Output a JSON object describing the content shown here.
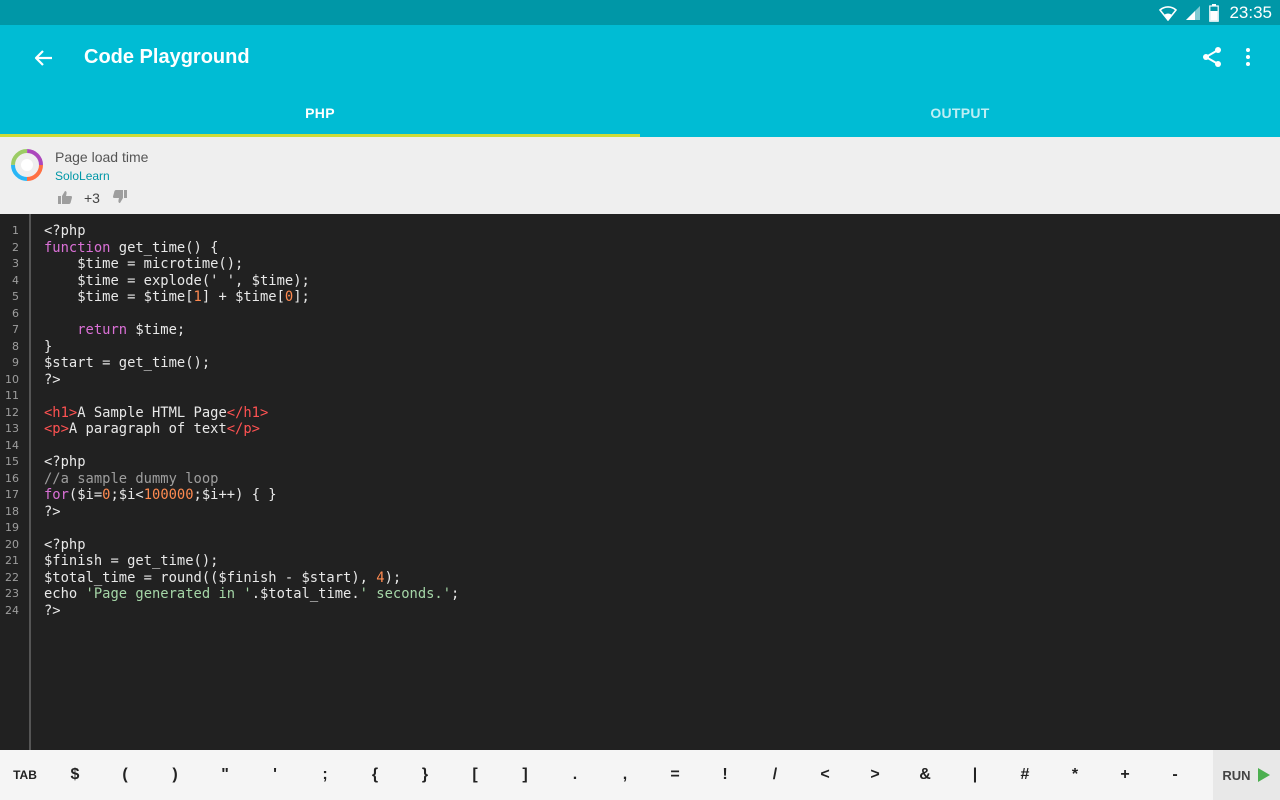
{
  "status": {
    "time": "23:35"
  },
  "appbar": {
    "title": "Code Playground"
  },
  "tabs": [
    {
      "label": "PHP"
    },
    {
      "label": "OUTPUT"
    }
  ],
  "info": {
    "title": "Page load time",
    "author": "SoloLearn",
    "votes": "+3"
  },
  "code_lines": [
    [
      [
        "<?php",
        ""
      ]
    ],
    [
      [
        "function",
        "kw"
      ],
      [
        " get_time() {",
        ""
      ]
    ],
    [
      [
        "    $time = microtime();",
        ""
      ]
    ],
    [
      [
        "    $time = explode(' ', $time);",
        ""
      ]
    ],
    [
      [
        "    $time = $time[",
        ""
      ],
      [
        "1",
        "num"
      ],
      [
        "] + $time[",
        ""
      ],
      [
        "0",
        "num"
      ],
      [
        "];",
        ""
      ]
    ],
    [],
    [
      [
        "    ",
        ""
      ],
      [
        "return",
        "kw"
      ],
      [
        " $time;",
        ""
      ]
    ],
    [
      [
        "}",
        ""
      ]
    ],
    [
      [
        "$start = get_time();",
        ""
      ]
    ],
    [
      [
        "?>",
        ""
      ]
    ],
    [],
    [
      [
        "<h1>",
        "tag"
      ],
      [
        "A Sample HTML Page",
        ""
      ],
      [
        "</h1>",
        "tag"
      ]
    ],
    [
      [
        "<p>",
        "tag"
      ],
      [
        "A paragraph of text",
        ""
      ],
      [
        "</p>",
        "tag"
      ]
    ],
    [],
    [
      [
        "<?php",
        ""
      ]
    ],
    [
      [
        "//a sample dummy loop",
        "com"
      ]
    ],
    [
      [
        "for",
        "kw"
      ],
      [
        "($i=",
        ""
      ],
      [
        "0",
        "num"
      ],
      [
        ";$i<",
        ""
      ],
      [
        "100000",
        "num"
      ],
      [
        ";$i++) { }",
        ""
      ]
    ],
    [
      [
        "?>",
        ""
      ]
    ],
    [],
    [
      [
        "<?php",
        ""
      ]
    ],
    [
      [
        "$finish = get_time();",
        ""
      ]
    ],
    [
      [
        "$total_time = round(($finish - $start), ",
        ""
      ],
      [
        "4",
        "num"
      ],
      [
        ");",
        ""
      ]
    ],
    [
      [
        "echo ",
        ""
      ],
      [
        "'Page generated in '",
        "str"
      ],
      [
        ".$total_time.",
        ""
      ],
      [
        "' seconds.'",
        "str"
      ],
      [
        ";",
        ""
      ]
    ],
    [
      [
        "?>",
        ""
      ]
    ]
  ],
  "keys": [
    "TAB",
    "$",
    "(",
    ")",
    "\"",
    "'",
    ";",
    "{",
    "}",
    "[",
    "]",
    ".",
    ",",
    "=",
    "!",
    "/",
    "<",
    ">",
    "&",
    "|",
    "#",
    "*",
    "+",
    "-"
  ],
  "run": {
    "label": "RUN"
  },
  "colors": {
    "status_bar": "#0097a7",
    "app_bar": "#00bcd4",
    "tab_indicator": "#cddc39",
    "editor_bg": "#212121",
    "author_link": "#0097a7",
    "run_icon": "#4caf50"
  }
}
